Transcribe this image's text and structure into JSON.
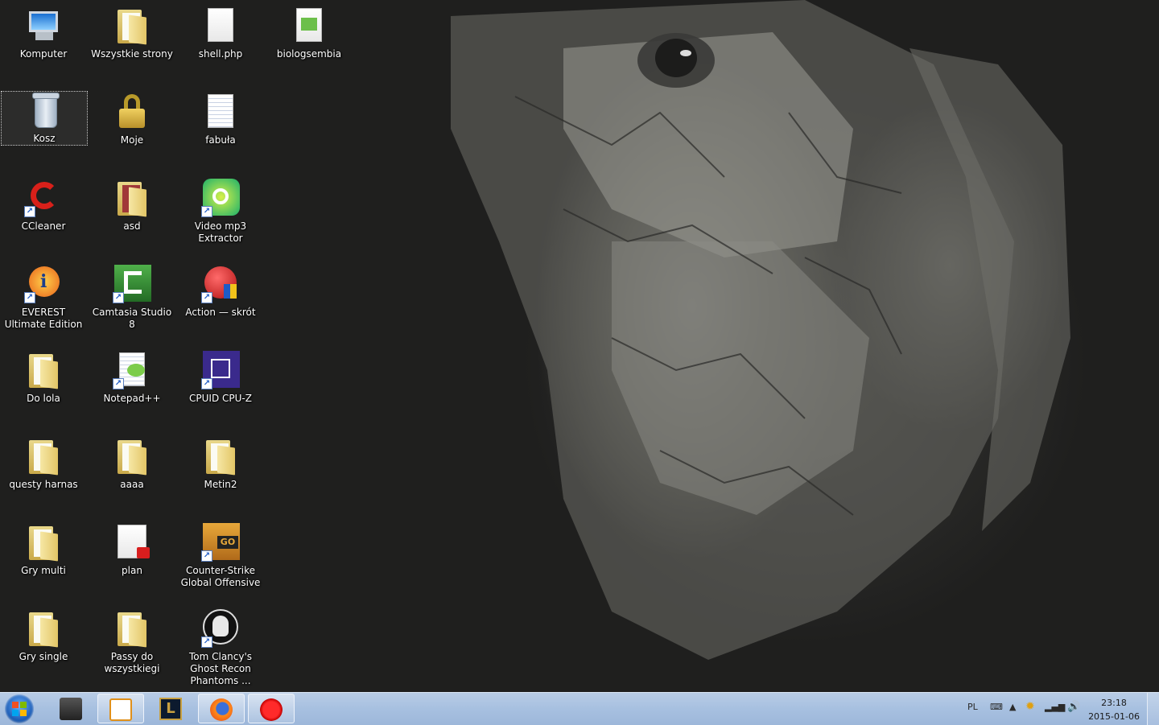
{
  "desktop": {
    "icons": [
      {
        "label": "Komputer"
      },
      {
        "label": "Wszystkie strony"
      },
      {
        "label": "shell.php"
      },
      {
        "label": "biologsembia"
      },
      {
        "label": "Kosz"
      },
      {
        "label": "Moje"
      },
      {
        "label": "fabuła"
      },
      {
        "label": "CCleaner"
      },
      {
        "label": "asd"
      },
      {
        "label": "Video mp3 Extractor"
      },
      {
        "label": "EVEREST Ultimate Edition"
      },
      {
        "label": "Camtasia Studio 8"
      },
      {
        "label": "Action — skrót"
      },
      {
        "label": "Do lola"
      },
      {
        "label": "Notepad++"
      },
      {
        "label": "CPUID CPU-Z"
      },
      {
        "label": "questy harnas"
      },
      {
        "label": "aaaa"
      },
      {
        "label": "Metin2"
      },
      {
        "label": "Gry multi"
      },
      {
        "label": "plan"
      },
      {
        "label": "Counter-Strike Global Offensive"
      },
      {
        "label": "Gry single"
      },
      {
        "label": "Passy do wszystkiegi"
      },
      {
        "label": "Tom Clancy's Ghost Recon Phantoms ..."
      }
    ]
  },
  "taskbar": {
    "pinned": [
      {
        "name": "truck-game-icon"
      },
      {
        "name": "media-player-icon"
      },
      {
        "name": "league-of-legends-icon"
      },
      {
        "name": "firefox-icon"
      },
      {
        "name": "red-gear-app-icon"
      }
    ],
    "tray": {
      "language": "PL",
      "time": "23:18",
      "date": "2015-01-06"
    }
  },
  "colors": {
    "taskbar": "#a7c0e0",
    "label_text": "#ffffff"
  }
}
